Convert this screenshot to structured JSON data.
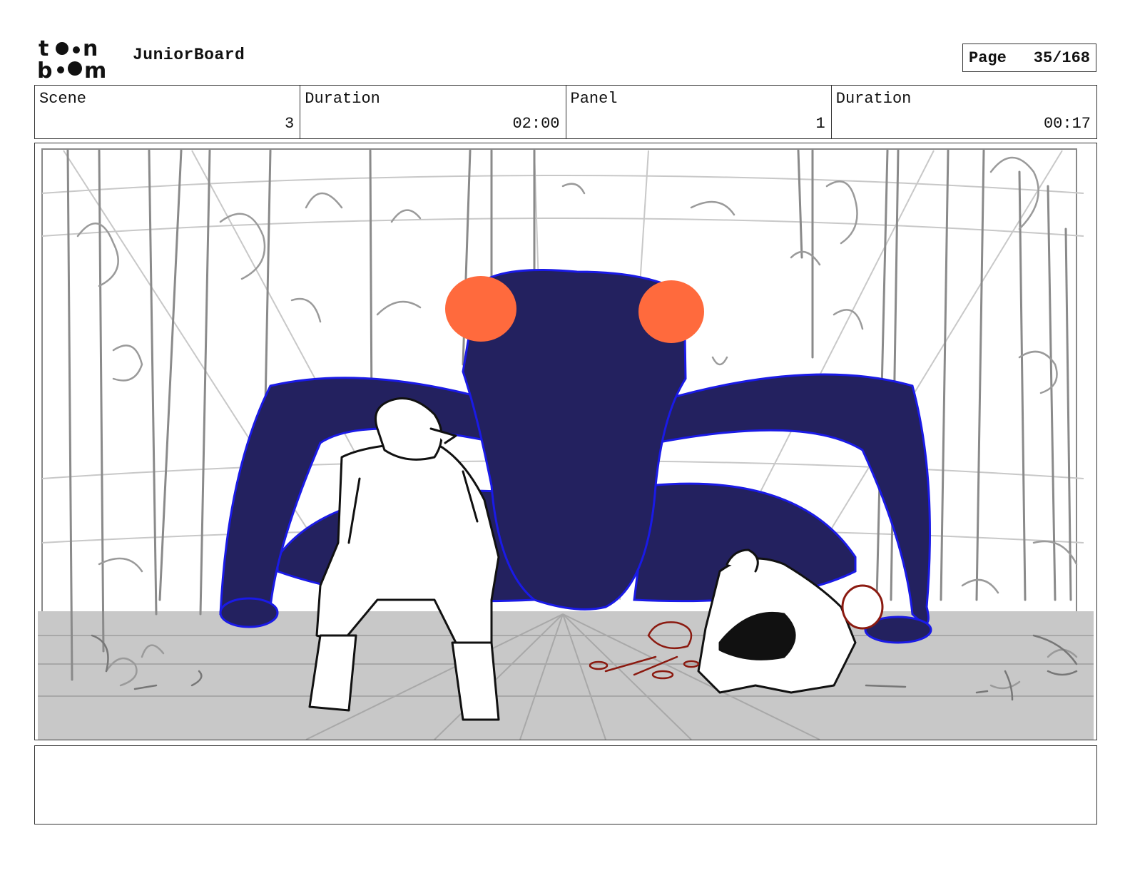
{
  "header": {
    "logo_top": "t●n",
    "logo_bottom": "b●●m",
    "logo_name": "toonboom-logo",
    "app_name": "JuniorBoard",
    "page_label": "Page",
    "page_value": "35/168"
  },
  "info": {
    "scene_label": "Scene",
    "scene_value": "3",
    "scene_duration_label": "Duration",
    "scene_duration_value": "02:00",
    "panel_label": "Panel",
    "panel_value": "1",
    "panel_duration_label": "Duration",
    "panel_duration_value": "00:17"
  },
  "panel": {
    "description": "",
    "colors": {
      "creature": "#23215f",
      "creature_outline": "#1a1ae6",
      "creature_eyes": "#ff6a3d",
      "ground": "#c8c8c8",
      "sketch_lines": "#9a9a9a",
      "blood": "#8b1a10"
    }
  },
  "notes": {
    "text": ""
  }
}
